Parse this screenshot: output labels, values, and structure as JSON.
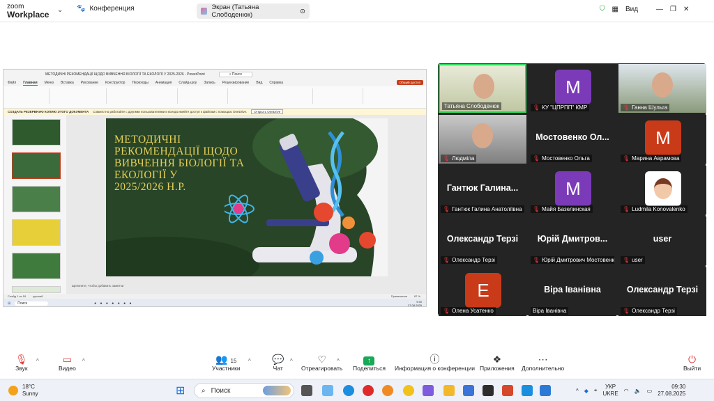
{
  "topbar": {
    "logo_top": "zoom",
    "logo_bottom": "Workplace",
    "conference_tab": "Конференция",
    "screen_tab": "Экран (Татьяна Слободенюк)",
    "view_label": "Вид"
  },
  "ppt": {
    "filename": "МЕТОДИЧНІ РЕКОМЕНДАЦІЇ ЩОДО ВИВЧЕННЯ БІОЛОГІЇ ТА ЕКОЛОГІЇ У 2025-2026 - PowerPoint",
    "search": "Поиск",
    "menu": [
      "Файл",
      "Главная",
      "Меню",
      "Вставка",
      "Рисование",
      "Конструктор",
      "Переходы",
      "Анимация",
      "Слайд-шоу",
      "Запись",
      "Рецензирование",
      "Вид",
      "Справка"
    ],
    "share_button": "Общий доступ",
    "warning": "СОЗДАТЬ РЕЗЕРВНУЮ КОПИЮ ЭТОГО ДОКУМЕНТА",
    "warning_text": "Совместно работайте с другими пользователями и всегда имейте доступ к файлам с помощью OneDrive.",
    "warning_button": "Открыть OneDrive",
    "slide_title": "МЕТОДИЧНІ\nРЕКОМЕНДАЦІЇ ЩОДО\nВИВЧЕННЯ БІОЛОГІЇ ТА\nЕКОЛОГІЇ У\n2025/2026 Н.Р.",
    "notes_placeholder": "Щелкните, чтобы добавить заметки",
    "status_slide": "Слайд 1 из 18",
    "status_lang": "русский",
    "status_notes": "Примечания",
    "zoom": "87 %",
    "inner_search": "Поиск",
    "inner_clock": "9:30",
    "inner_date": "27.08.2025"
  },
  "participants": [
    {
      "name": "Татьяна Слободенюк",
      "type": "video",
      "muted": false
    },
    {
      "name": "КУ \"ЦПРПП\" КМР",
      "type": "avatar",
      "letter": "M",
      "color": "#7b3ab8",
      "muted": true
    },
    {
      "name": "Ганна Шульга",
      "type": "video",
      "muted": true
    },
    {
      "name": "Людміла",
      "type": "video",
      "muted": true
    },
    {
      "name": "Мостовенко Ольга",
      "type": "text",
      "display": "Мостовенко Ол...",
      "muted": true
    },
    {
      "name": "Марина Аврамова",
      "type": "avatar",
      "letter": "M",
      "color": "#c93a18",
      "muted": true
    },
    {
      "name": "Гантюк Галина Анатоліївна",
      "type": "text",
      "display": "Гантюк Галина...",
      "muted": true
    },
    {
      "name": "Майя Базелинская",
      "type": "avatar",
      "letter": "M",
      "color": "#7b3ab8",
      "muted": true
    },
    {
      "name": "Ludmila Konovalenko",
      "type": "cartoon",
      "muted": true
    },
    {
      "name": "Олександр Терзі",
      "type": "text",
      "display": "Олександр Терзі",
      "muted": true
    },
    {
      "name": "Юрій Дмитрович Мостовенко",
      "type": "text",
      "display": "Юрій Дмитров...",
      "label": "Юрій Дмитрович Мостовенк...",
      "muted": true
    },
    {
      "name": "user",
      "type": "text",
      "display": "user",
      "muted": true
    },
    {
      "name": "Олена Усатенко",
      "type": "avatar",
      "letter": "E",
      "color": "#c93a18",
      "muted": true
    },
    {
      "name": "Віра Іванівна",
      "type": "text",
      "display": "Віра Іванівна",
      "muted": false
    },
    {
      "name": "Олександр Терзі",
      "type": "text",
      "display": "Олександр Терзі",
      "muted": true
    }
  ],
  "controls": {
    "audio": "Звук",
    "video": "Видео",
    "participants": "Участники",
    "participants_count": "15",
    "chat": "Чат",
    "react": "Отреагировать",
    "share": "Поделиться",
    "info": "Информация о конференции",
    "apps": "Приложения",
    "more": "Дополнительно",
    "leave": "Выйти"
  },
  "taskbar": {
    "temp": "18°C",
    "weather": "Sunny",
    "search": "Поиск",
    "lang_top": "УКР",
    "lang_bottom": "UKRE",
    "time": "09:30",
    "date": "27.08.2025"
  }
}
